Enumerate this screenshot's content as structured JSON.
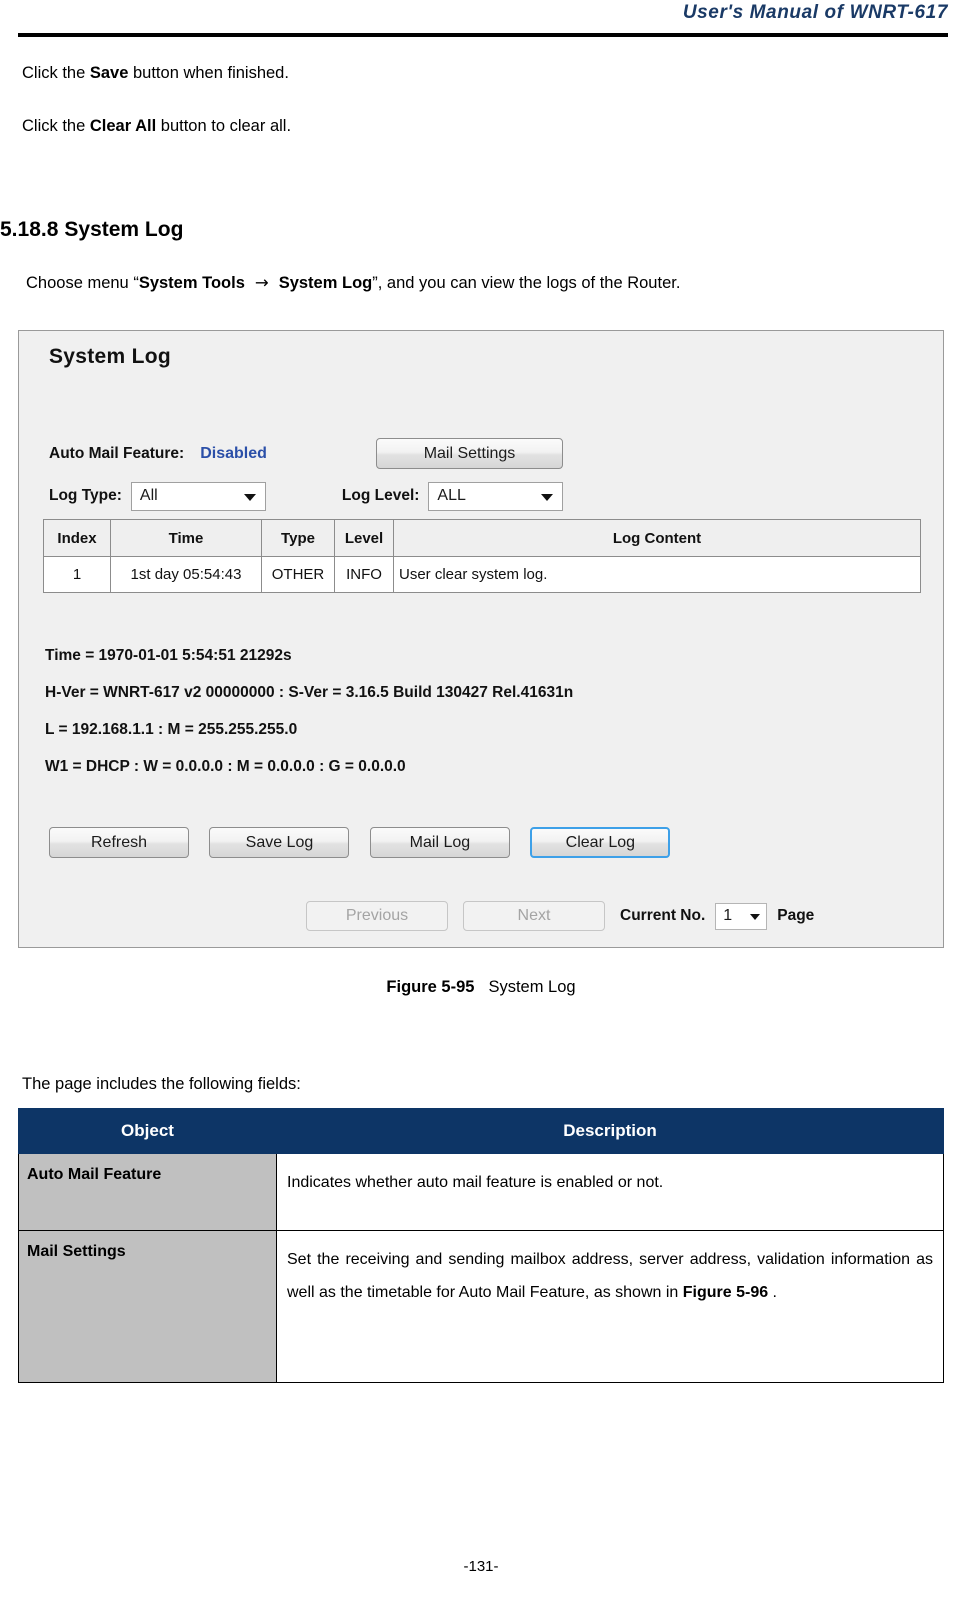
{
  "header": {
    "title": "User's Manual of WNRT-617"
  },
  "intro": {
    "save_line_pre": "Click the ",
    "save_line_bold": "Save",
    "save_line_post": " button when finished.",
    "clear_line_pre": "Click the ",
    "clear_line_bold": "Clear All",
    "clear_line_post": " button to clear all."
  },
  "section": {
    "number": "5.18.8",
    "title": "System Log",
    "choose_pre": "Choose menu “",
    "choose_bold1": "System Tools",
    "choose_arrow": "→",
    "choose_bold2": "System Log",
    "choose_post": "”, and you can view the logs of the Router."
  },
  "router_panel": {
    "title": "System Log",
    "auto_mail_label": "Auto Mail Feature:",
    "auto_mail_value": "Disabled",
    "auto_mail_value_color": "#2b4fa8",
    "mail_settings_button": "Mail Settings",
    "log_type_label": "Log Type:",
    "log_type_value": "All",
    "log_level_label": "Log Level:",
    "log_level_value": "ALL",
    "table": {
      "columns": [
        "Index",
        "Time",
        "Type",
        "Level",
        "Log Content"
      ],
      "rows": [
        [
          "1",
          "1st day 05:54:43",
          "OTHER",
          "INFO",
          "User clear system log."
        ]
      ]
    },
    "info_lines": [
      "Time = 1970-01-01 5:54:51 21292s",
      "H-Ver = WNRT-617 v2 00000000 : S-Ver = 3.16.5 Build 130427 Rel.41631n",
      "L = 192.168.1.1 : M = 255.255.255.0",
      "W1 = DHCP : W = 0.0.0.0 : M = 0.0.0.0 : G = 0.0.0.0"
    ],
    "buttons": {
      "refresh": "Refresh",
      "save_log": "Save Log",
      "mail_log": "Mail Log",
      "clear_log": "Clear Log",
      "focus_color": "#3da0e8"
    },
    "pager": {
      "previous": "Previous",
      "next": "Next",
      "current_label": "Current No.",
      "current_value": "1",
      "page_label": "Page"
    }
  },
  "figure": {
    "number": "Figure 5-95",
    "caption": "System Log"
  },
  "fields_intro": "The page includes the following fields:",
  "fields_table": {
    "headers": [
      "Object",
      "Description"
    ],
    "header_bg": "#0d3566",
    "object_cell_bg": "#c0c0c0",
    "rows": [
      {
        "object": "Auto Mail Feature",
        "description": "Indicates whether auto mail feature is enabled or not.",
        "description_bold": "",
        "description_tail": ""
      },
      {
        "object": "Mail Settings",
        "description": "Set the receiving and sending mailbox address, server address, validation information as well as the timetable for Auto Mail Feature, as shown in ",
        "description_bold": "Figure 5-96",
        "description_tail": "  ."
      }
    ]
  },
  "footer": {
    "page_number": "-131-"
  }
}
